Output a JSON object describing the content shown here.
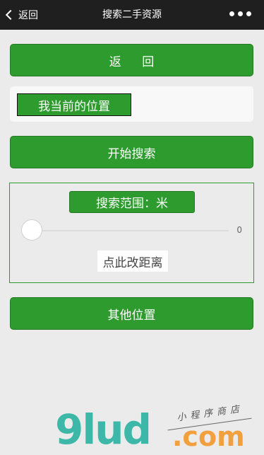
{
  "navbar": {
    "back_label": "返回",
    "title": "搜索二手资源"
  },
  "buttons": {
    "back": "返 回",
    "current_location": "我当前的位置",
    "start_search": "开始搜索",
    "other_location": "其他位置"
  },
  "range": {
    "label": "搜索范围：米",
    "slider_value": "0",
    "change_distance": "点此改距离"
  },
  "watermark": {
    "logo": "9lud",
    "domain": ".com",
    "subtitle": "小程序商店"
  },
  "colors": {
    "primary_green": "#2e9b2e",
    "navbar_bg": "#1f1f1f",
    "page_bg": "#ebebeb"
  }
}
